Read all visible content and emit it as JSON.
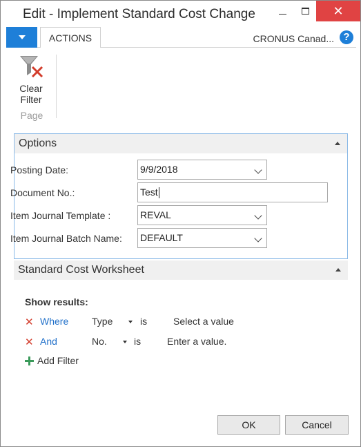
{
  "window": {
    "title": "Edit - Implement Standard Cost Change",
    "minimize_glyph": "",
    "close_glyph": "✕"
  },
  "ribbon": {
    "tab_label": "ACTIONS",
    "company": "CRONUS Canad...",
    "help_glyph": "?",
    "clear_filter_label_1": "Clear",
    "clear_filter_label_2": "Filter",
    "group_label": "Page"
  },
  "options": {
    "header": "Options",
    "fields": [
      {
        "label": "Posting Date:",
        "value": "9/9/2018",
        "type": "select"
      },
      {
        "label": "Document No.:",
        "value": "Test",
        "type": "text"
      },
      {
        "label": "Item Journal Template :",
        "value": "REVAL",
        "type": "select"
      },
      {
        "label": "Item Journal Batch Name:",
        "value": "DEFAULT",
        "type": "select"
      }
    ]
  },
  "worksheet": {
    "header": "Standard Cost Worksheet",
    "show_results": "Show results:",
    "filters": [
      {
        "conj": "Where",
        "field": "Type",
        "op": "is",
        "value": "Select a value"
      },
      {
        "conj": "And",
        "field": "No.",
        "op": "is",
        "value": "Enter a value."
      }
    ],
    "add_filter": "Add Filter"
  },
  "buttons": {
    "ok": "OK",
    "cancel": "Cancel"
  },
  "colors": {
    "accent": "#1e7fd8",
    "close_red": "#e04343",
    "filter_x": "#d23b2a",
    "add_green": "#3a9a5a",
    "tab_border": "#88b8e6"
  }
}
